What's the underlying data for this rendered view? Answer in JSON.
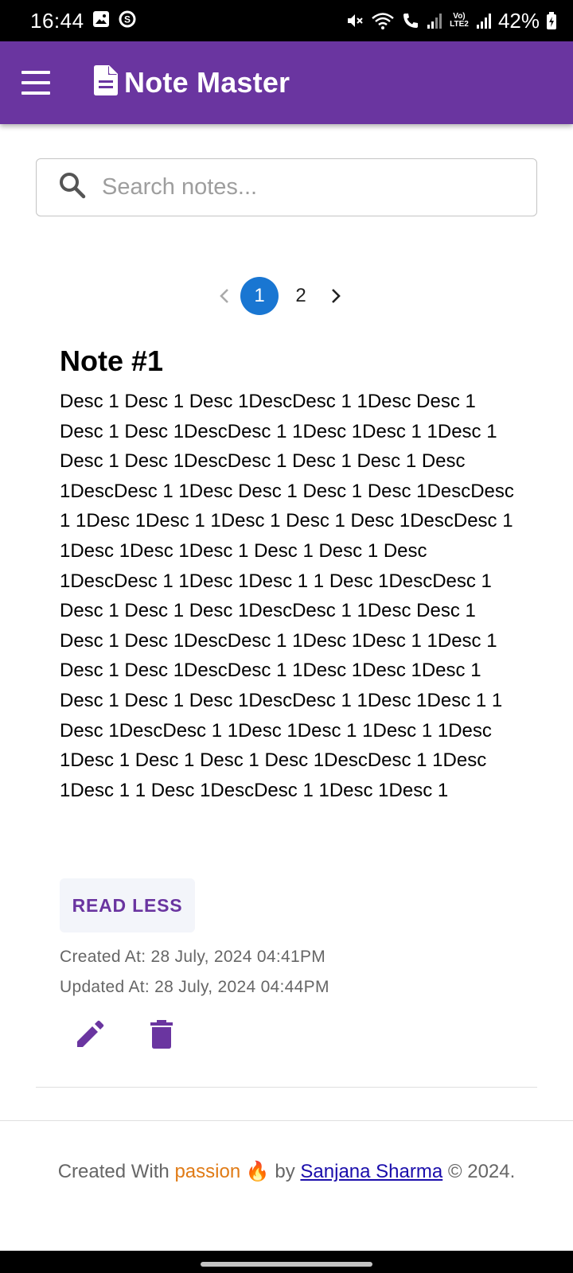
{
  "status_bar": {
    "time": "16:44",
    "battery": "42%",
    "network_tag": "Vo) LTE2",
    "left_icons": [
      "image-icon",
      "s-app-icon"
    ],
    "right_icons": [
      "mute-icon",
      "wifi-icon",
      "call-icon",
      "signal-icon",
      "signal-icon",
      "battery-icon"
    ]
  },
  "app_bar": {
    "title": "Note Master",
    "background": "#6a35a0"
  },
  "search": {
    "placeholder": "Search notes..."
  },
  "pagination": {
    "pages": [
      "1",
      "2"
    ],
    "current": "1",
    "active_color": "#1976d2"
  },
  "note": {
    "title": "Note #1",
    "description": "Desc 1 Desc 1 Desc 1DescDesc 1 1Desc Desc 1 Desc 1 Desc 1DescDesc 1 1Desc 1Desc 1 1Desc 1 Desc 1 Desc 1DescDesc 1 Desc 1 Desc 1 Desc 1DescDesc 1 1Desc Desc 1 Desc 1 Desc 1DescDesc 1 1Desc 1Desc 1 1Desc 1 Desc 1 Desc 1DescDesc 1 1Desc 1Desc 1Desc 1 Desc 1 Desc 1 Desc 1DescDesc 1 1Desc 1Desc 1 1 Desc 1DescDesc 1 Desc 1 Desc 1 Desc 1DescDesc 1 1Desc Desc 1 Desc 1 Desc 1DescDesc 1 1Desc 1Desc 1 1Desc 1 Desc 1 Desc 1DescDesc 1 1Desc 1Desc 1Desc 1 Desc 1 Desc 1 Desc 1DescDesc 1 1Desc 1Desc 1 1 Desc 1DescDesc 1 1Desc 1Desc 1 1Desc 1 1Desc 1Desc 1 Desc 1 Desc 1 Desc 1DescDesc 1 1Desc 1Desc 1 1 Desc 1DescDesc 1 1Desc 1Desc 1",
    "read_less_label": "READ LESS",
    "created_at": "Created At: 28 July, 2024 04:41PM",
    "updated_at": "Updated At: 28 July, 2024 04:44PM",
    "accent": "#6a35a0"
  },
  "footer": {
    "prefix": "Created With ",
    "passion": "passion",
    "emoji": "🔥",
    "by": " by ",
    "author": "Sanjana Sharma",
    "suffix": " © 2024."
  }
}
